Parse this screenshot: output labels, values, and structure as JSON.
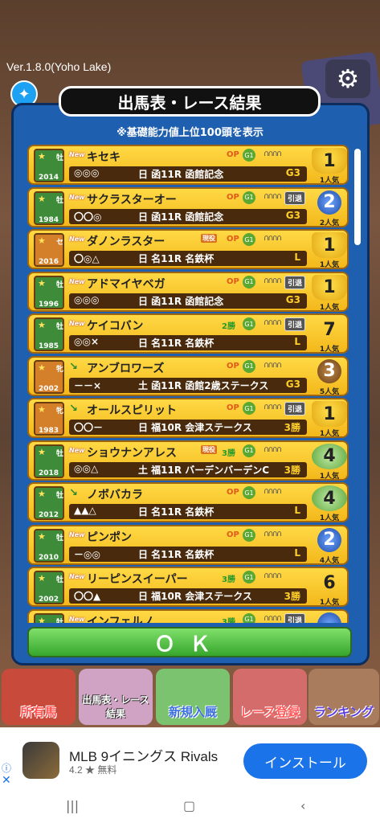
{
  "version": "Ver.1.8.0(Yoho Lake)",
  "dialog": {
    "title": "出馬表・レース結果",
    "subtitle": "※基礎能力値上位100頭を表示",
    "ok_label": "ＯＫ"
  },
  "horses": [
    {
      "name": "キセキ",
      "sex": "牡",
      "year": "2014",
      "prefix": "New",
      "tag": "OP",
      "marks": "◎◎◎",
      "race": "日 函11R 函館記念",
      "grade": "G3",
      "rank": "1",
      "pop": "1人気",
      "retired": false,
      "genki": false,
      "rank_type": "gold"
    },
    {
      "name": "サクラスターオー",
      "sex": "牡",
      "year": "1984",
      "prefix": "New",
      "tag": "OP",
      "marks": "〇〇◎",
      "race": "日 函11R 函館記念",
      "grade": "G3",
      "rank": "2",
      "pop": "2人気",
      "retired": true,
      "genki": false,
      "rank_type": "blue"
    },
    {
      "name": "ダノンラスター",
      "sex": "セ",
      "year": "2016",
      "prefix": "New",
      "tag": "OP",
      "marks": "〇◎△",
      "race": "日 名11R 名鉄杯",
      "grade": "L",
      "rank": "1",
      "pop": "1人気",
      "retired": false,
      "genki": true,
      "rank_type": "gold"
    },
    {
      "name": "アドマイヤベガ",
      "sex": "牡",
      "year": "1996",
      "prefix": "New",
      "tag": "OP",
      "marks": "◎◎◎",
      "race": "日 函11R 函館記念",
      "grade": "G3",
      "rank": "1",
      "pop": "1人気",
      "retired": true,
      "genki": false,
      "rank_type": "gold"
    },
    {
      "name": "ケイコバン",
      "sex": "牡",
      "year": "1985",
      "prefix": "New",
      "tag": "2勝",
      "marks": "◎◎×",
      "race": "日 名11R 名鉄杯",
      "grade": "L",
      "rank": "7",
      "pop": "1人気",
      "retired": true,
      "genki": false,
      "rank_type": "plain"
    },
    {
      "name": "アンブロワーズ",
      "sex": "牝",
      "year": "2002",
      "prefix": "↘",
      "tag": "OP",
      "marks": "－－×",
      "race": "土 函11R 函館2歳ステークス",
      "grade": "G3",
      "rank": "3",
      "pop": "5人気",
      "retired": false,
      "genki": false,
      "rank_type": "bronze"
    },
    {
      "name": "オールスピリット",
      "sex": "牝",
      "year": "1983",
      "prefix": "↘",
      "tag": "OP",
      "marks": "〇〇－",
      "race": "日 福10R 会津ステークス",
      "grade": "3勝",
      "rank": "1",
      "pop": "1人気",
      "retired": true,
      "genki": false,
      "rank_type": "gold"
    },
    {
      "name": "ショウナンアレス",
      "sex": "牡",
      "year": "2018",
      "prefix": "New",
      "tag": "3勝",
      "marks": "◎◎△",
      "race": "土 福11R バーデンバーデンC",
      "grade": "3勝",
      "rank": "4",
      "pop": "1人気",
      "retired": false,
      "genki": true,
      "rank_type": "wreath"
    },
    {
      "name": "ノボバカラ",
      "sex": "牡",
      "year": "2012",
      "prefix": "↘",
      "tag": "OP",
      "marks": "▲▲△",
      "race": "日 名11R 名鉄杯",
      "grade": "L",
      "rank": "4",
      "pop": "1人気",
      "retired": false,
      "genki": false,
      "rank_type": "wreath"
    },
    {
      "name": "ピンポン",
      "sex": "牡",
      "year": "2010",
      "prefix": "New",
      "tag": "OP",
      "marks": "－◎◎",
      "race": "日 名11R 名鉄杯",
      "grade": "L",
      "rank": "2",
      "pop": "4人気",
      "retired": false,
      "genki": false,
      "rank_type": "blue"
    },
    {
      "name": "リーピンスイーパー",
      "sex": "牡",
      "year": "2002",
      "prefix": "New",
      "tag": "3勝",
      "marks": "〇〇▲",
      "race": "日 福10R 会津ステークス",
      "grade": "3勝",
      "rank": "6",
      "pop": "1人気",
      "retired": false,
      "genki": false,
      "rank_type": "plain"
    },
    {
      "name": "インフェルノ",
      "sex": "牡",
      "year": "",
      "prefix": "New",
      "tag": "3勝",
      "marks": "",
      "race": "",
      "grade": "",
      "rank": "",
      "pop": "",
      "retired": true,
      "genki": false,
      "rank_type": "blue"
    }
  ],
  "labels": {
    "genki": "現役",
    "retired": "引退"
  },
  "nav": [
    "所有馬",
    "出馬表・レース結果",
    "新規入厩",
    "レース登録",
    "ランキング"
  ],
  "ad": {
    "title": "MLB 9イニングス Rivals",
    "rating": "4.2 ★ 無料",
    "button": "インストール"
  }
}
